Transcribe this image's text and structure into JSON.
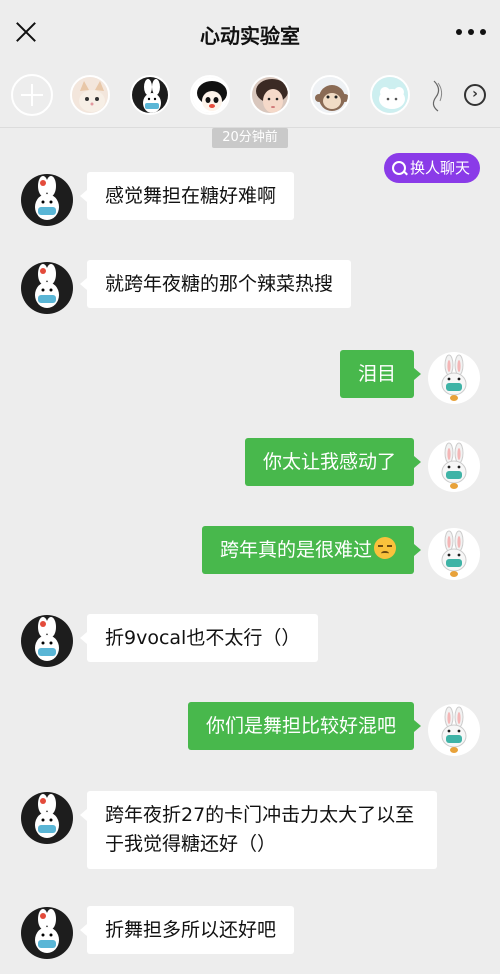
{
  "header": {
    "title": "心动实验室"
  },
  "member_bar": {
    "members": [
      {
        "name": "member-avatar-cat"
      },
      {
        "name": "member-avatar-bunny-dark"
      },
      {
        "name": "member-avatar-cartoon-girl"
      },
      {
        "name": "member-avatar-girl-photo"
      },
      {
        "name": "member-avatar-monkey"
      },
      {
        "name": "member-avatar-cloud"
      },
      {
        "name": "member-avatar-sketch"
      }
    ]
  },
  "timestamp": "20分钟前",
  "switch_chat_label": "换人聊天",
  "colors": {
    "accent_purple": "#8a3be8",
    "bubble_green": "#48b84c",
    "background": "#ededed"
  },
  "messages": [
    {
      "side": "left",
      "text": "感觉舞担在糖好难啊"
    },
    {
      "side": "left",
      "text": "就跨年夜糖的那个辣菜热搜"
    },
    {
      "side": "right",
      "text": "泪目"
    },
    {
      "side": "right",
      "text": "你太让我感动了"
    },
    {
      "side": "right",
      "text": "跨年真的是很难过",
      "emoji": "pensive-face"
    },
    {
      "side": "left",
      "text": "折9vocal也不太行（）"
    },
    {
      "side": "right",
      "text": "你们是舞担比较好混吧"
    },
    {
      "side": "left",
      "text": "跨年夜折27的卡门冲击力太大了以至于我觉得糖还好（）"
    },
    {
      "side": "left",
      "text": "折舞担多所以还好吧"
    }
  ]
}
